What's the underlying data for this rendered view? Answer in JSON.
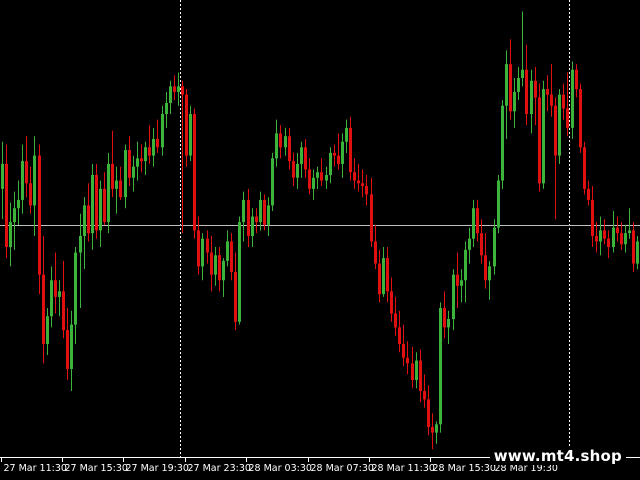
{
  "chart_data": {
    "type": "candlestick",
    "background_color": "#000000",
    "bull_color": "#3cb43c",
    "bear_color": "#e01010",
    "grid": false,
    "horizontal_level": 0.0,
    "period_separators_after_candle": [
      44,
      139
    ],
    "x_tick_labels": [
      "27 Mar 11:30",
      "27 Mar 15:30",
      "27 Mar 19:30",
      "27 Mar 23:30",
      "28 Mar 03:30",
      "28 Mar 07:30",
      "28 Mar 11:30",
      "28 Mar 15:30",
      "28 Mar 19:30"
    ],
    "x_tick_every_n_candles": 15,
    "y_range": [
      -8.2,
      7.9
    ],
    "candles": [
      [
        0.0,
        2.0,
        -0.5,
        1.3
      ],
      [
        1.3,
        3.0,
        0.2,
        2.2
      ],
      [
        2.2,
        2.9,
        -1.2,
        -0.8
      ],
      [
        -0.8,
        0.8,
        -1.5,
        0.1
      ],
      [
        0.1,
        1.2,
        -0.9,
        0.6
      ],
      [
        0.6,
        1.6,
        0.0,
        0.9
      ],
      [
        0.9,
        2.9,
        0.4,
        2.3
      ],
      [
        2.3,
        3.2,
        1.0,
        1.5
      ],
      [
        1.5,
        2.1,
        0.4,
        0.7
      ],
      [
        0.7,
        3.2,
        -0.4,
        2.5
      ],
      [
        2.5,
        2.9,
        -2.5,
        -1.8
      ],
      [
        -1.8,
        -0.4,
        -5.0,
        -4.3
      ],
      [
        -4.3,
        -3.0,
        -4.7,
        -3.3
      ],
      [
        -3.3,
        -1.5,
        -3.7,
        -2.0
      ],
      [
        -2.0,
        -1.0,
        -3.2,
        -2.6
      ],
      [
        -2.6,
        -2.0,
        -3.3,
        -2.4
      ],
      [
        -2.4,
        -1.3,
        -4.1,
        -3.8
      ],
      [
        -3.8,
        -3.0,
        -5.6,
        -5.2
      ],
      [
        -5.2,
        -3.1,
        -6.0,
        -3.6
      ],
      [
        -3.6,
        -0.8,
        -4.3,
        -1.0
      ],
      [
        -1.0,
        0.4,
        -3.0,
        -0.4
      ],
      [
        -0.4,
        1.0,
        -1.6,
        0.7
      ],
      [
        0.7,
        1.5,
        -0.6,
        -0.3
      ],
      [
        -0.3,
        2.2,
        -0.9,
        1.8
      ],
      [
        1.8,
        2.2,
        -0.5,
        -0.2
      ],
      [
        -0.2,
        1.6,
        -0.8,
        1.3
      ],
      [
        1.3,
        1.9,
        0.0,
        0.1
      ],
      [
        0.1,
        2.6,
        -0.3,
        2.2
      ],
      [
        2.2,
        3.4,
        1.0,
        1.3
      ],
      [
        1.3,
        2.1,
        0.4,
        1.6
      ],
      [
        1.6,
        2.1,
        0.9,
        1.0
      ],
      [
        1.0,
        2.9,
        0.6,
        2.7
      ],
      [
        2.7,
        3.2,
        1.4,
        1.7
      ],
      [
        1.7,
        2.5,
        1.2,
        2.1
      ],
      [
        2.1,
        3.0,
        1.6,
        2.4
      ],
      [
        2.4,
        2.9,
        1.9,
        2.3
      ],
      [
        2.3,
        3.0,
        1.8,
        2.8
      ],
      [
        2.8,
        3.6,
        2.2,
        2.5
      ],
      [
        2.5,
        3.5,
        2.1,
        3.1
      ],
      [
        3.1,
        3.8,
        2.6,
        2.8
      ],
      [
        2.8,
        4.3,
        2.5,
        4.0
      ],
      [
        4.0,
        4.8,
        3.5,
        4.4
      ],
      [
        4.4,
        5.2,
        4.0,
        5.0
      ],
      [
        5.0,
        5.4,
        4.5,
        4.8
      ],
      [
        4.8,
        5.5,
        4.3,
        5.0
      ],
      [
        5.0,
        5.2,
        -0.3,
        4.7
      ],
      [
        4.7,
        4.9,
        2.1,
        2.5
      ],
      [
        2.5,
        4.3,
        2.3,
        4.0
      ],
      [
        4.0,
        4.2,
        -0.5,
        -0.2
      ],
      [
        -0.2,
        0.3,
        -1.8,
        -1.5
      ],
      [
        -1.5,
        -0.3,
        -2.0,
        -0.5
      ],
      [
        -0.5,
        -0.2,
        -1.4,
        -1.0
      ],
      [
        -1.0,
        -0.4,
        -2.4,
        -1.8
      ],
      [
        -1.8,
        -0.8,
        -2.2,
        -1.1
      ],
      [
        -1.1,
        -0.8,
        -2.4,
        -2.0
      ],
      [
        -2.0,
        -1.2,
        -2.6,
        -1.3
      ],
      [
        -1.3,
        -0.2,
        -1.5,
        -0.6
      ],
      [
        -0.6,
        -0.3,
        -2.0,
        -1.7
      ],
      [
        -1.7,
        -1.0,
        -3.8,
        -3.5
      ],
      [
        -3.5,
        0.3,
        -3.6,
        0.1
      ],
      [
        0.1,
        1.2,
        -0.6,
        0.9
      ],
      [
        0.9,
        1.3,
        -0.8,
        -0.4
      ],
      [
        -0.4,
        0.6,
        -0.8,
        0.3
      ],
      [
        0.3,
        0.6,
        -0.3,
        0.1
      ],
      [
        0.1,
        1.2,
        -0.2,
        0.9
      ],
      [
        0.9,
        1.1,
        -0.2,
        0.0
      ],
      [
        0.0,
        1.0,
        -0.4,
        0.7
      ],
      [
        0.7,
        2.6,
        0.5,
        2.4
      ],
      [
        2.4,
        3.8,
        2.1,
        3.3
      ],
      [
        3.3,
        3.6,
        2.4,
        2.8
      ],
      [
        2.8,
        3.5,
        2.5,
        3.2
      ],
      [
        3.2,
        3.5,
        2.0,
        2.3
      ],
      [
        2.3,
        2.6,
        1.4,
        1.7
      ],
      [
        1.7,
        2.6,
        1.3,
        2.2
      ],
      [
        2.2,
        3.0,
        1.7,
        2.8
      ],
      [
        2.8,
        3.1,
        1.7,
        2.0
      ],
      [
        2.0,
        2.4,
        1.1,
        1.3
      ],
      [
        1.3,
        2.0,
        0.9,
        1.7
      ],
      [
        1.7,
        2.1,
        1.3,
        1.9
      ],
      [
        1.9,
        2.4,
        1.4,
        1.6
      ],
      [
        1.6,
        2.1,
        1.3,
        1.8
      ],
      [
        1.8,
        2.8,
        1.5,
        2.6
      ],
      [
        2.6,
        2.9,
        2.1,
        2.5
      ],
      [
        2.5,
        3.3,
        2.0,
        2.2
      ],
      [
        2.2,
        3.3,
        1.7,
        3.0
      ],
      [
        3.0,
        3.8,
        2.6,
        3.5
      ],
      [
        3.5,
        3.9,
        1.6,
        1.9
      ],
      [
        1.9,
        2.4,
        1.3,
        1.6
      ],
      [
        1.6,
        2.2,
        1.2,
        1.5
      ],
      [
        1.5,
        2.0,
        1.0,
        1.4
      ],
      [
        1.4,
        1.8,
        0.7,
        1.1
      ],
      [
        1.1,
        1.7,
        -0.8,
        -0.6
      ],
      [
        -0.6,
        0.0,
        -1.6,
        -1.4
      ],
      [
        -1.4,
        -0.9,
        -2.8,
        -2.5
      ],
      [
        -2.5,
        -0.8,
        -2.6,
        -1.2
      ],
      [
        -1.2,
        -0.8,
        -2.8,
        -2.4
      ],
      [
        -2.4,
        -1.9,
        -3.5,
        -3.2
      ],
      [
        -3.2,
        -2.6,
        -4.0,
        -3.7
      ],
      [
        -3.7,
        -3.1,
        -4.6,
        -4.3
      ],
      [
        -4.3,
        -3.6,
        -5.1,
        -4.8
      ],
      [
        -4.8,
        -4.2,
        -5.4,
        -5.0
      ],
      [
        -5.0,
        -4.4,
        -5.9,
        -5.6
      ],
      [
        -5.6,
        -4.6,
        -5.9,
        -4.9
      ],
      [
        -4.9,
        -4.5,
        -6.4,
        -6.0
      ],
      [
        -6.0,
        -5.4,
        -6.6,
        -6.3
      ],
      [
        -6.3,
        -5.8,
        -7.6,
        -7.3
      ],
      [
        -7.3,
        -6.8,
        -8.1,
        -7.5
      ],
      [
        -7.5,
        -7.1,
        -7.9,
        -7.2
      ],
      [
        -7.2,
        -2.8,
        -7.5,
        -3.0
      ],
      [
        -3.0,
        -2.4,
        -4.1,
        -3.7
      ],
      [
        -3.7,
        -3.1,
        -4.3,
        -3.4
      ],
      [
        -3.4,
        -1.6,
        -3.8,
        -1.8
      ],
      [
        -1.8,
        -1.0,
        -3.0,
        -2.2
      ],
      [
        -2.2,
        -1.6,
        -2.8,
        -2.0
      ],
      [
        -2.0,
        -0.6,
        -2.8,
        -0.9
      ],
      [
        -0.9,
        -0.1,
        -1.4,
        -0.5
      ],
      [
        -0.5,
        0.9,
        -0.8,
        0.6
      ],
      [
        0.6,
        0.9,
        -0.6,
        -0.3
      ],
      [
        -0.3,
        0.2,
        -1.4,
        -1.1
      ],
      [
        -1.1,
        -0.3,
        -2.3,
        -2.0
      ],
      [
        -2.0,
        -1.3,
        -2.7,
        -1.5
      ],
      [
        -1.5,
        0.2,
        -1.8,
        -0.1
      ],
      [
        -0.1,
        1.8,
        -0.3,
        1.6
      ],
      [
        1.6,
        4.5,
        1.3,
        4.3
      ],
      [
        4.3,
        6.3,
        3.1,
        5.8
      ],
      [
        5.8,
        6.7,
        3.8,
        4.1
      ],
      [
        4.1,
        5.3,
        3.5,
        4.8
      ],
      [
        4.8,
        5.7,
        4.5,
        5.3
      ],
      [
        5.3,
        7.7,
        5.0,
        5.6
      ],
      [
        5.6,
        6.5,
        3.6,
        4.0
      ],
      [
        4.0,
        5.6,
        3.3,
        5.2
      ],
      [
        5.2,
        5.7,
        3.6,
        4.6
      ],
      [
        4.6,
        5.1,
        1.2,
        1.5
      ],
      [
        1.5,
        5.2,
        1.3,
        4.9
      ],
      [
        4.9,
        5.4,
        4.1,
        4.7
      ],
      [
        4.7,
        5.8,
        3.9,
        4.3
      ],
      [
        4.3,
        4.6,
        0.2,
        2.5
      ],
      [
        2.5,
        4.9,
        2.2,
        4.7
      ],
      [
        4.7,
        5.1,
        3.8,
        4.2
      ],
      [
        4.2,
        5.5,
        3.2,
        3.5
      ],
      [
        3.5,
        5.9,
        3.1,
        5.6
      ],
      [
        5.6,
        5.8,
        4.6,
        4.9
      ],
      [
        4.9,
        5.1,
        2.6,
        2.8
      ],
      [
        2.8,
        3.0,
        1.1,
        1.3
      ],
      [
        1.3,
        1.6,
        0.7,
        0.9
      ],
      [
        0.9,
        1.4,
        -0.8,
        -0.4
      ],
      [
        -0.4,
        0.1,
        -1.0,
        -0.6
      ],
      [
        -0.6,
        0.3,
        -1.1,
        -0.2
      ],
      [
        -0.2,
        0.2,
        -0.7,
        -0.5
      ],
      [
        -0.5,
        -0.2,
        -1.2,
        -0.8
      ],
      [
        -0.8,
        0.5,
        -1.0,
        -0.1
      ],
      [
        -0.1,
        0.3,
        -0.6,
        -0.3
      ],
      [
        -0.3,
        0.1,
        -0.9,
        -0.7
      ],
      [
        -0.7,
        0.0,
        -1.0,
        -0.3
      ],
      [
        -0.3,
        0.6,
        -0.5,
        -0.2
      ],
      [
        -0.2,
        0.1,
        -1.7,
        -1.4
      ],
      [
        -1.4,
        -0.4,
        -1.6,
        -0.6
      ],
      [
        -0.6,
        0.8,
        -0.8,
        0.5
      ],
      [
        0.5,
        0.8,
        -0.3,
        -0.2
      ],
      [
        -0.2,
        0.0,
        -1.3,
        -0.9
      ],
      [
        -0.9,
        -0.3,
        -1.5,
        -0.5
      ],
      [
        -0.5,
        0.4,
        -0.7,
        0.1
      ],
      [
        0.1,
        0.4,
        -0.6,
        -0.4
      ],
      [
        -0.4,
        0.1,
        -1.6,
        -1.0
      ],
      [
        -1.0,
        0.0,
        -1.2,
        -0.3
      ],
      [
        -0.3,
        0.2,
        -0.8,
        -0.5
      ],
      [
        -0.5,
        0.4,
        -0.7,
        0.3
      ],
      [
        0.3,
        1.1,
        -0.1,
        0.7
      ],
      [
        0.7,
        0.9,
        0.1,
        0.4
      ],
      [
        0.4,
        1.0,
        0.0,
        0.2
      ],
      [
        0.2,
        0.9,
        -0.2,
        0.5
      ],
      [
        0.5,
        0.8,
        -0.3,
        -0.1
      ],
      [
        -0.1,
        0.4,
        -0.4,
        0.2
      ],
      [
        0.2,
        0.6,
        -0.3,
        0.4
      ],
      [
        0.4,
        1.1,
        -0.1,
        0.8
      ],
      [
        0.8,
        1.2,
        -0.2,
        0.0
      ],
      [
        0.0,
        0.4,
        -0.9,
        -0.5
      ],
      [
        -0.5,
        1.5,
        -0.7,
        1.2
      ],
      [
        1.2,
        1.5,
        -0.3,
        0.1
      ],
      [
        0.1,
        0.4,
        -0.5,
        0.2
      ],
      [
        0.2,
        1.2,
        -0.1,
        0.9
      ],
      [
        0.9,
        1.3,
        -0.4,
        -0.3
      ],
      [
        -0.3,
        0.4,
        -1.3,
        -0.9
      ]
    ]
  },
  "watermark": "www.mt4.shop"
}
